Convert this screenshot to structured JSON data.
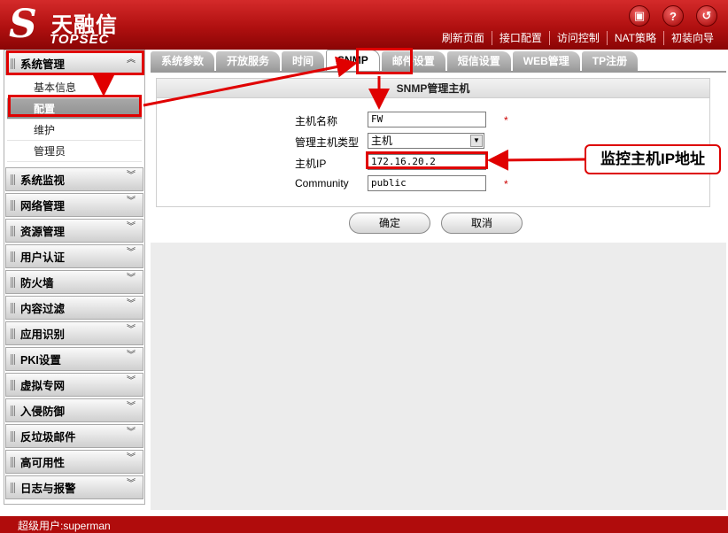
{
  "header": {
    "logo_symbol": "S",
    "logo_cn": "天融信",
    "logo_en": "TOPSEC",
    "icons": [
      "save-icon",
      "help-icon",
      "logout-icon"
    ],
    "nav": [
      "刷新页面",
      "接口配置",
      "访问控制",
      "NAT策略",
      "初装向导"
    ]
  },
  "sidebar": {
    "expanded": {
      "label": "系统管理",
      "items": [
        "基本信息",
        "配置",
        "维护",
        "管理员"
      ],
      "active_index": 1
    },
    "groups": [
      "系统监视",
      "网络管理",
      "资源管理",
      "用户认证",
      "防火墙",
      "内容过滤",
      "应用识别",
      "PKI设置",
      "虚拟专网",
      "入侵防御",
      "反垃圾邮件",
      "高可用性",
      "日志与报警"
    ]
  },
  "tabs": [
    "系统参数",
    "开放服务",
    "时间",
    "SNMP",
    "邮件设置",
    "短信设置",
    "WEB管理",
    "TP注册"
  ],
  "active_tab_index": 3,
  "form": {
    "title": "SNMP管理主机",
    "host_name_label": "主机名称",
    "host_name_value": "FW",
    "host_type_label": "管理主机类型",
    "host_type_value": "主机",
    "host_ip_label": "主机IP",
    "host_ip_value": "172.16.20.2",
    "community_label": "Community",
    "community_value": "public",
    "required_mark": "*",
    "ok_label": "确定",
    "cancel_label": "取消"
  },
  "annotation": {
    "callout": "监控主机IP地址",
    "accent_color": "#e00000"
  },
  "footer": {
    "user": "超级用户:superman"
  },
  "colors": {
    "header": "#b01010",
    "footer": "#b00c0c"
  }
}
